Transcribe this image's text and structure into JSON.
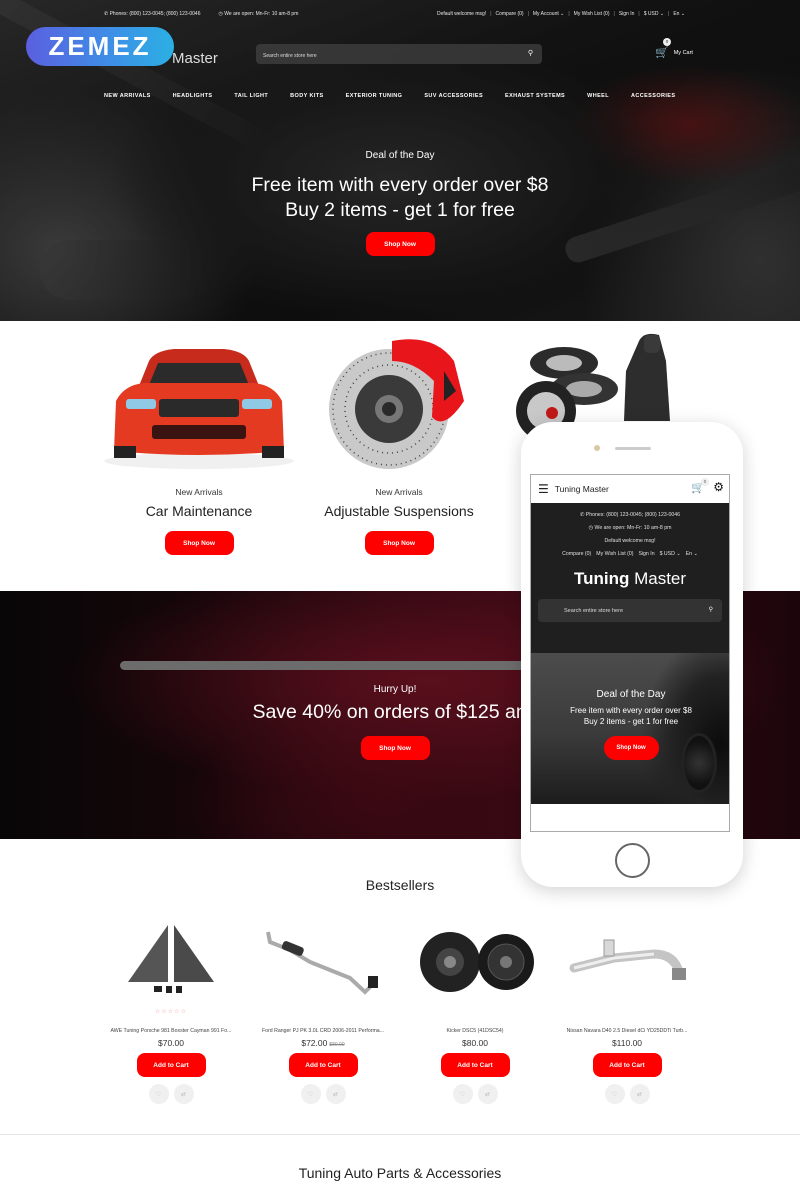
{
  "topbar": {
    "phones": "Phones: (800) 123-0045; (800) 123-0046",
    "hours": "We are open: Mn-Fr: 10 am-8 pm",
    "welcome": "Default welcome msg!",
    "compare": "Compare (0)",
    "account": "My Account",
    "wishlist": "My Wish List (0)",
    "signin": "Sign In",
    "currency": "$ USD",
    "language": "En"
  },
  "header": {
    "badge_text": "ZEMEZ",
    "logo_tail": "Master",
    "search_placeholder": "Search entire store here",
    "cart_label": "My Cart",
    "cart_count": "0"
  },
  "nav": [
    "NEW ARRIVALS",
    "HEADLIGHTS",
    "TAIL LIGHT",
    "BODY KITS",
    "EXTERIOR TUNING",
    "SUV ACCESSORIES",
    "EXHAUST SYSTEMS",
    "WHEEL",
    "ACCESSORIES"
  ],
  "hero": {
    "kicker": "Deal of the Day",
    "line1": "Free item with every order over $8",
    "line2": "Buy 2 items - get 1 for free",
    "button": "Shop Now"
  },
  "categories": [
    {
      "sub": "New Arrivals",
      "title": "Car Maintenance",
      "button": "Shop Now",
      "image": "red sports car"
    },
    {
      "sub": "New Arrivals",
      "title": "Adjustable Suspensions",
      "button": "Shop Now",
      "image": "brake disc with red caliper"
    },
    {
      "image": "tires and car seat"
    }
  ],
  "promo": {
    "kicker": "Hurry Up!",
    "headline": "Save 40% on orders of $125 and",
    "button": "Shop Now"
  },
  "bestsellers": {
    "title": "Bestsellers",
    "products": [
      {
        "name": "AWE Tuning Porsche 981 Boxster Cayman 991 Fo...",
        "price": "$70.00",
        "old_price": "",
        "stars": "☆☆☆☆☆",
        "button": "Add to Cart"
      },
      {
        "name": "Ford Ranger PJ PK 3.0L CRD 2006-2011 Performa...",
        "price": "$72.00",
        "old_price": "$80.00",
        "stars": "",
        "button": "Add to Cart"
      },
      {
        "name": "Kicker DSC5 (41DSC54)",
        "price": "$80.00",
        "old_price": "",
        "stars": "",
        "button": "Add to Cart"
      },
      {
        "name": "Nissan Navara D40 2.5 Diesel dCi YD25DDTi Turb...",
        "price": "$110.00",
        "old_price": "",
        "stars": "",
        "button": "Add to Cart"
      }
    ]
  },
  "bottom_title": "Tuning Auto Parts & Accessories",
  "mobile": {
    "store_name": "Tuning Master",
    "cart_count": "0",
    "phones": "Phones: (800) 123-0045; (800) 123-0046",
    "hours": "We are open: Mn-Fr: 10 am-8 pm",
    "welcome": "Default welcome msg!",
    "compare": "Compare (0)",
    "wishlist": "My Wish List (0)",
    "signin": "Sign In",
    "currency": "$ USD",
    "language": "En",
    "brand_bold": "Tuning",
    "brand_light": "Master",
    "search_placeholder": "Search entire store here",
    "hero_kicker": "Deal of the Day",
    "hero_line1": "Free item with every order over $8",
    "hero_line2": "Buy 2 items - get 1 for free",
    "hero_button": "Shop Now"
  },
  "colors": {
    "accent": "#ff0000",
    "badge_start": "#5b5fe0",
    "badge_end": "#2bb0e4",
    "dark": "#1f1f1f"
  }
}
